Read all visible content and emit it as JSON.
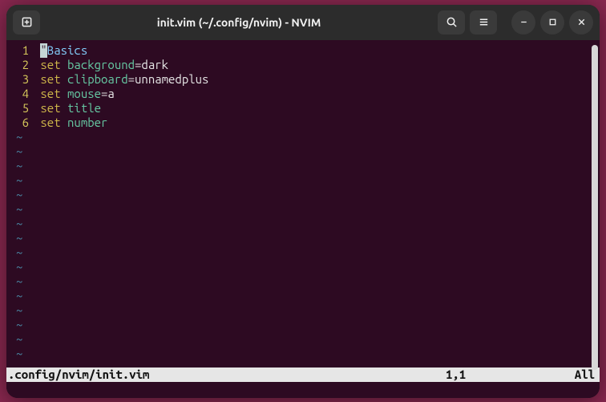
{
  "window": {
    "title": "init.vim (~/.config/nvim) - NVIM"
  },
  "file": {
    "path": ".config/nvim/init.vim",
    "cursor": "1,1",
    "scroll": "All"
  },
  "code": {
    "lines": [
      {
        "n": "1",
        "tokens": [
          {
            "t": "cursor",
            "v": "\""
          },
          {
            "t": "comment",
            "v": "Basics"
          }
        ]
      },
      {
        "n": "2",
        "tokens": [
          {
            "t": "keyword",
            "v": "set"
          },
          {
            "t": "text",
            "v": " "
          },
          {
            "t": "option",
            "v": "background"
          },
          {
            "t": "text",
            "v": "=dark"
          }
        ]
      },
      {
        "n": "3",
        "tokens": [
          {
            "t": "keyword",
            "v": "set"
          },
          {
            "t": "text",
            "v": " "
          },
          {
            "t": "option",
            "v": "clipboard"
          },
          {
            "t": "text",
            "v": "=unnamedplus"
          }
        ]
      },
      {
        "n": "4",
        "tokens": [
          {
            "t": "keyword",
            "v": "set"
          },
          {
            "t": "text",
            "v": " "
          },
          {
            "t": "option",
            "v": "mouse"
          },
          {
            "t": "text",
            "v": "=a"
          }
        ]
      },
      {
        "n": "5",
        "tokens": [
          {
            "t": "keyword",
            "v": "set"
          },
          {
            "t": "text",
            "v": " "
          },
          {
            "t": "option",
            "v": "title"
          }
        ]
      },
      {
        "n": "6",
        "tokens": [
          {
            "t": "keyword",
            "v": "set"
          },
          {
            "t": "text",
            "v": " "
          },
          {
            "t": "option",
            "v": "number"
          }
        ]
      }
    ],
    "tilde": "~",
    "empty_rows": 16
  }
}
